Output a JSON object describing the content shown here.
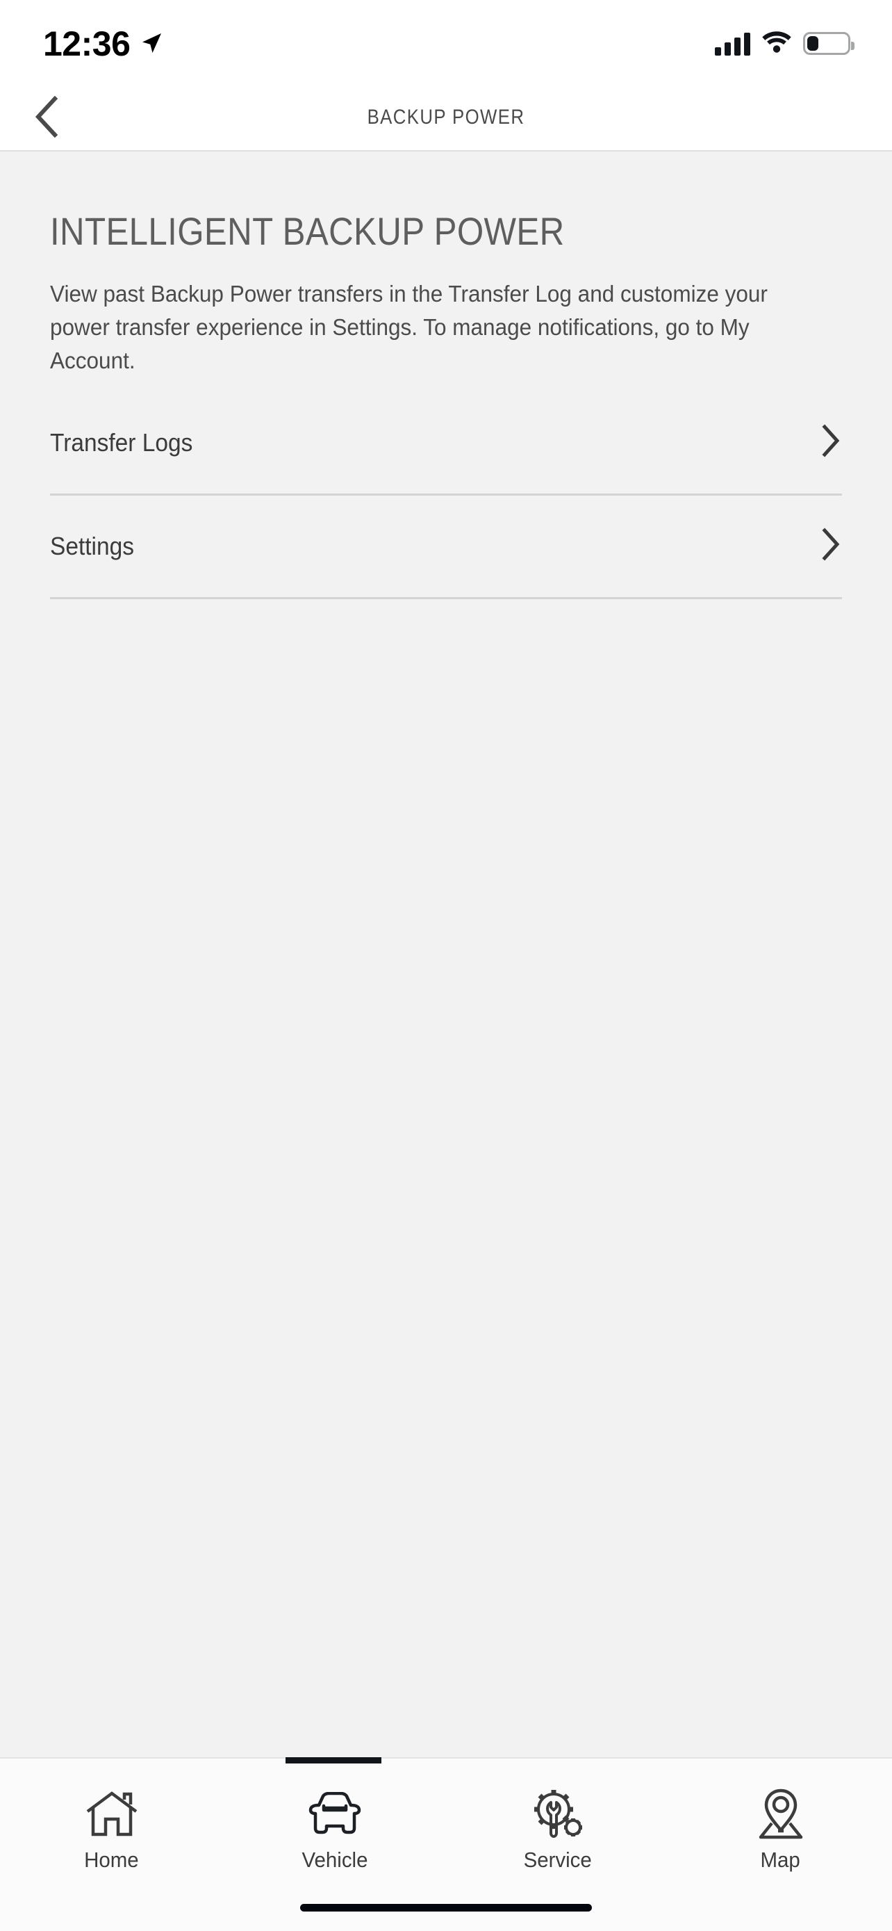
{
  "status_bar": {
    "time": "12:36",
    "location_icon": "location-arrow-icon",
    "cellular_icon": "cellular-signal-icon",
    "cellular_bars": 4,
    "wifi_icon": "wifi-icon",
    "battery_icon": "battery-icon",
    "battery_level_percent": 25
  },
  "nav_bar": {
    "back_icon": "chevron-left-icon",
    "title": "BACKUP POWER"
  },
  "main": {
    "heading": "INTELLIGENT BACKUP POWER",
    "description": "View past Backup Power transfers in the Transfer Log and customize your power transfer experience in Settings. To manage notifications, go to My Account.",
    "rows": [
      {
        "label": "Transfer Logs",
        "chevron_icon": "chevron-right-icon"
      },
      {
        "label": "Settings",
        "chevron_icon": "chevron-right-icon"
      }
    ]
  },
  "tab_bar": {
    "active_index": 1,
    "tabs": [
      {
        "label": "Home",
        "icon": "house-icon"
      },
      {
        "label": "Vehicle",
        "icon": "car-front-icon"
      },
      {
        "label": "Service",
        "icon": "gear-wrench-icon"
      },
      {
        "label": "Map",
        "icon": "map-pin-icon"
      }
    ]
  },
  "colors": {
    "background": "#f2f2f2",
    "surface": "#ffffff",
    "text_primary": "#3b3b3b",
    "text_secondary": "#5e5e5e",
    "divider": "#d4d4d4",
    "accent": "#111418"
  }
}
